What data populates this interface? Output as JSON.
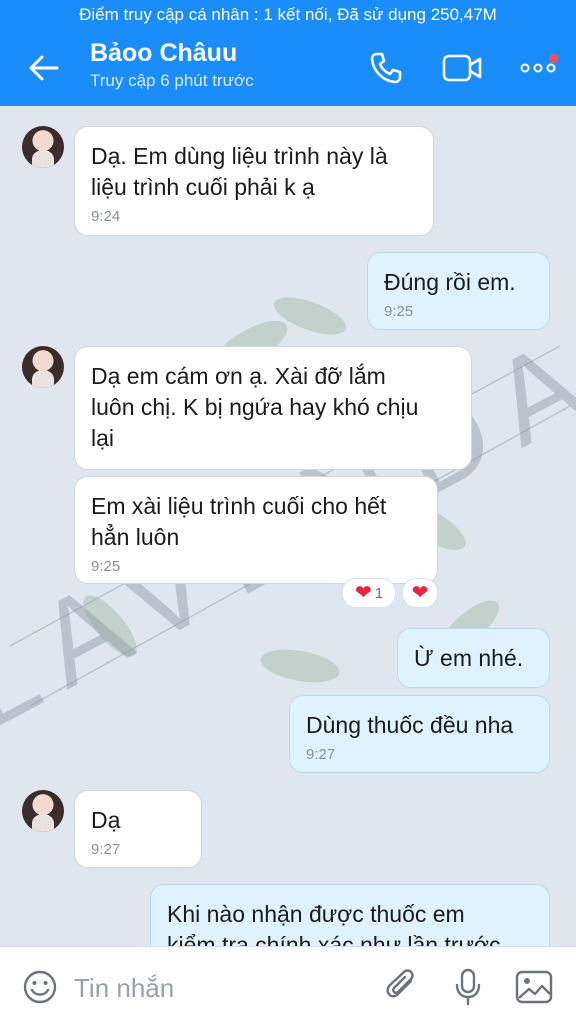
{
  "status_bar": {
    "text": "Điểm truy cập cá nhân : 1 kết nối, Đã sử dụng 250,47M"
  },
  "header": {
    "name": "Bảoo Châuu",
    "status": "Truy cập 6 phút trước"
  },
  "watermark": {
    "text": "LAVENDA"
  },
  "messages": [
    {
      "side": "in",
      "lines": [
        "Dạ. Em dùng liệu trình này là",
        "liệu trình cuối phải k ạ"
      ],
      "time": "9:24"
    },
    {
      "side": "out",
      "lines": [
        "Đúng rồi em."
      ],
      "time": "9:25"
    },
    {
      "side": "in",
      "lines": [
        "Dạ em cám ơn ạ. Xài đỡ lắm",
        "luôn chị. K bị ngứa hay khó chịu",
        "lại"
      ],
      "time": ""
    },
    {
      "side": "in",
      "lines": [
        "Em xài liệu trình cuối cho hết",
        "hẳn luôn"
      ],
      "time": "9:25",
      "reaction_count": "1"
    },
    {
      "side": "out",
      "lines": [
        "Ừ em nhé."
      ],
      "time": ""
    },
    {
      "side": "out",
      "lines": [
        "Dùng thuốc đều nha"
      ],
      "time": "9:27"
    },
    {
      "side": "in",
      "lines": [
        "Dạ"
      ],
      "time": "9:27"
    },
    {
      "side": "out",
      "lines": [
        "Khi nào nhận được thuốc em",
        "kiểm tra chính xác như lần trước"
      ],
      "time": ""
    }
  ],
  "composer": {
    "placeholder": "Tin nhắn"
  },
  "colors": {
    "accent": "#1a8dfb",
    "out_bubble": "#dff3fe",
    "in_bubble": "#ffffff",
    "heart": "#e8233a"
  }
}
